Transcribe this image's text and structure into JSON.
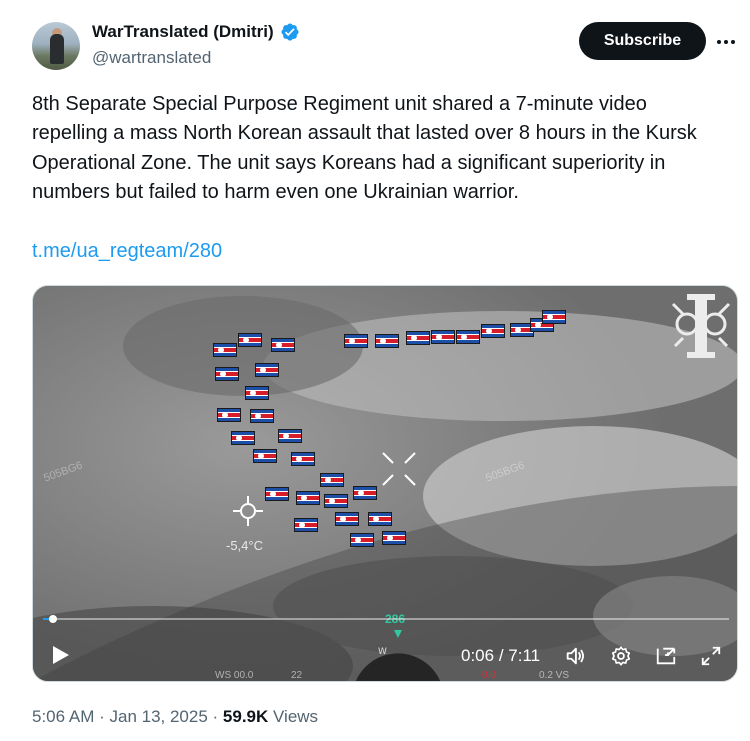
{
  "author": {
    "display_name": "WarTranslated (Dmitri)",
    "handle": "@wartranslated",
    "verified": true
  },
  "header": {
    "subscribe_label": "Subscribe",
    "more_icon": "ellipsis-icon"
  },
  "tweet": {
    "text": "8th Separate Special Purpose Regiment unit shared a 7-minute video repelling a mass North Korean assault that lasted over 8 hours in the Kursk Operational Zone. The unit says Koreans had a significant superiority in numbers but failed to harm even one Ukrainian warrior.",
    "link": "t.me/ua_regteam/280"
  },
  "video": {
    "current_time": "0:06",
    "separator": " / ",
    "duration": "7:11",
    "progress": 0.014,
    "overlay": {
      "temperature": "-5,4°C",
      "compass_heading": "286",
      "compass_letter": "W",
      "hud_left": "WS 00.0",
      "hud_left2": "22",
      "hud_mid": "0.0",
      "hud_right": "0.2 VS",
      "watermark": "505BG6"
    },
    "controls": {
      "play_icon": "play-icon",
      "volume_icon": "volume-icon",
      "settings_icon": "gear-icon",
      "pip_icon": "picture-in-picture-icon",
      "fullscreen_icon": "fullscreen-icon"
    }
  },
  "meta": {
    "time": "5:06 AM",
    "date": "Jan 13, 2025",
    "views_count": "59.9K",
    "views_label": "Views"
  },
  "colors": {
    "accent": "#1d9bf0",
    "text_primary": "#0f1419",
    "text_secondary": "#536471"
  }
}
